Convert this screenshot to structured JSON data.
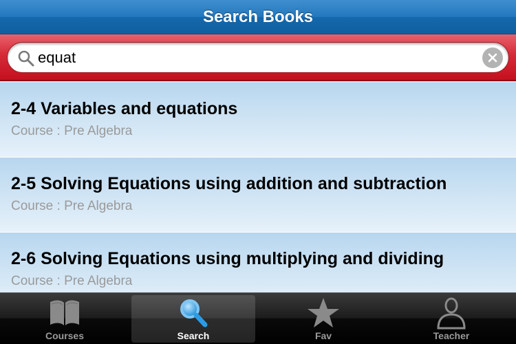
{
  "navbar": {
    "title": "Search Books"
  },
  "search": {
    "value": "equat"
  },
  "results": [
    {
      "title": "2-4 Variables and equations",
      "course": "Course : Pre Algebra"
    },
    {
      "title": "2-5 Solving Equations using addition and subtraction",
      "course": "Course : Pre Algebra"
    },
    {
      "title": "2-6 Solving Equations using multiplying and dividing",
      "course": "Course : Pre Algebra"
    }
  ],
  "tabs": [
    {
      "label": "Courses",
      "icon": "book-icon",
      "active": false
    },
    {
      "label": "Search",
      "icon": "search-icon",
      "active": true
    },
    {
      "label": "Fav",
      "icon": "star-icon",
      "active": false
    },
    {
      "label": "Teacher",
      "icon": "person-icon",
      "active": false
    }
  ],
  "colors": {
    "navbar": "#1f70b5",
    "searchbar": "#d11f2d",
    "row": "#c6def2",
    "subtitle": "#9a9a9a",
    "tabbar": "#111111"
  }
}
